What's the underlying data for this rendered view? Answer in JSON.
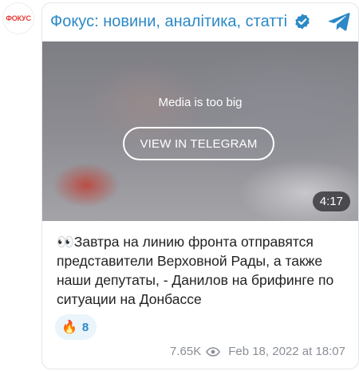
{
  "avatar": {
    "text": "ФОКУС"
  },
  "header": {
    "channel_name": "Фокус: новини, аналітика, статті"
  },
  "media": {
    "message": "Media is too big",
    "button_label": "VIEW IN TELEGRAM",
    "duration": "4:17"
  },
  "post": {
    "text": "👀Завтра на линию фронта отправятся представители Верховной Рады, а также наши депутаты, - Данилов на брифинге по ситуации на Донбассе"
  },
  "reactions": [
    {
      "emoji": "🔥",
      "count": "8"
    }
  ],
  "meta": {
    "views": "7.65K",
    "date": "Feb 18, 2022 at 18:07"
  },
  "colors": {
    "accent": "#2c89c6",
    "reaction_bg": "#eaf4fb",
    "meta_text": "#8a8f96"
  }
}
